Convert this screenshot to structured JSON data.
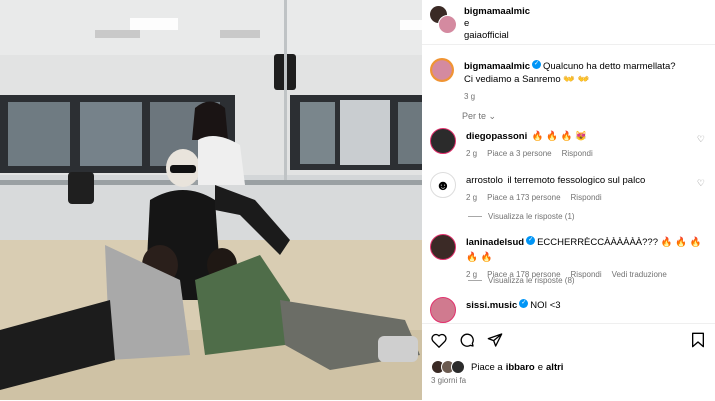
{
  "post": {
    "header_user": "bigmamaalmic",
    "header_sep": "e",
    "header_collab": "gaiaofficial",
    "caption_user": "bigmamaalmic",
    "caption_line1": "Qualcuno ha detto marmellata?",
    "caption_line2": "Ci vediamo a Sanremo 👐 👐",
    "caption_time": "3 g",
    "filter_label": "Per te"
  },
  "comments": [
    {
      "user": "diegopassoni",
      "verified": false,
      "text": "🔥 🔥 🔥 😻",
      "time": "2 g",
      "likes": "Piace a 3 persone",
      "reply": "Rispondi",
      "translate": ""
    },
    {
      "user": "arrostolo",
      "verified": false,
      "text": "il terremoto fessologico sul palco",
      "time": "2 g",
      "likes": "Piace a 173 persone",
      "reply": "Rispondi",
      "translate": "",
      "view_replies": "Visualizza le risposte (1)"
    },
    {
      "user": "laninadelsud",
      "verified": true,
      "text": "ECCHERRÈCCÀÀÀÀÀÀ??? 🔥 🔥 🔥 🔥 🔥",
      "time": "2 g",
      "likes": "Piace a 178 persone",
      "reply": "Rispondi",
      "translate": "Vedi traduzione",
      "view_replies": "Visualizza le risposte (8)"
    },
    {
      "user": "sissi.music",
      "verified": true,
      "text": "NOI <3",
      "time": "",
      "likes": "",
      "reply": "",
      "translate": ""
    }
  ],
  "footer": {
    "likes_prefix": "Piace a",
    "likes_user": "ibbaro",
    "likes_and": "e",
    "likes_others": "altri",
    "time": "3 giorni fa"
  },
  "colors": {
    "accent": "#0095f6",
    "muted": "#737373",
    "floor": "#d9cdb3",
    "wall": "#e4e6e6"
  }
}
